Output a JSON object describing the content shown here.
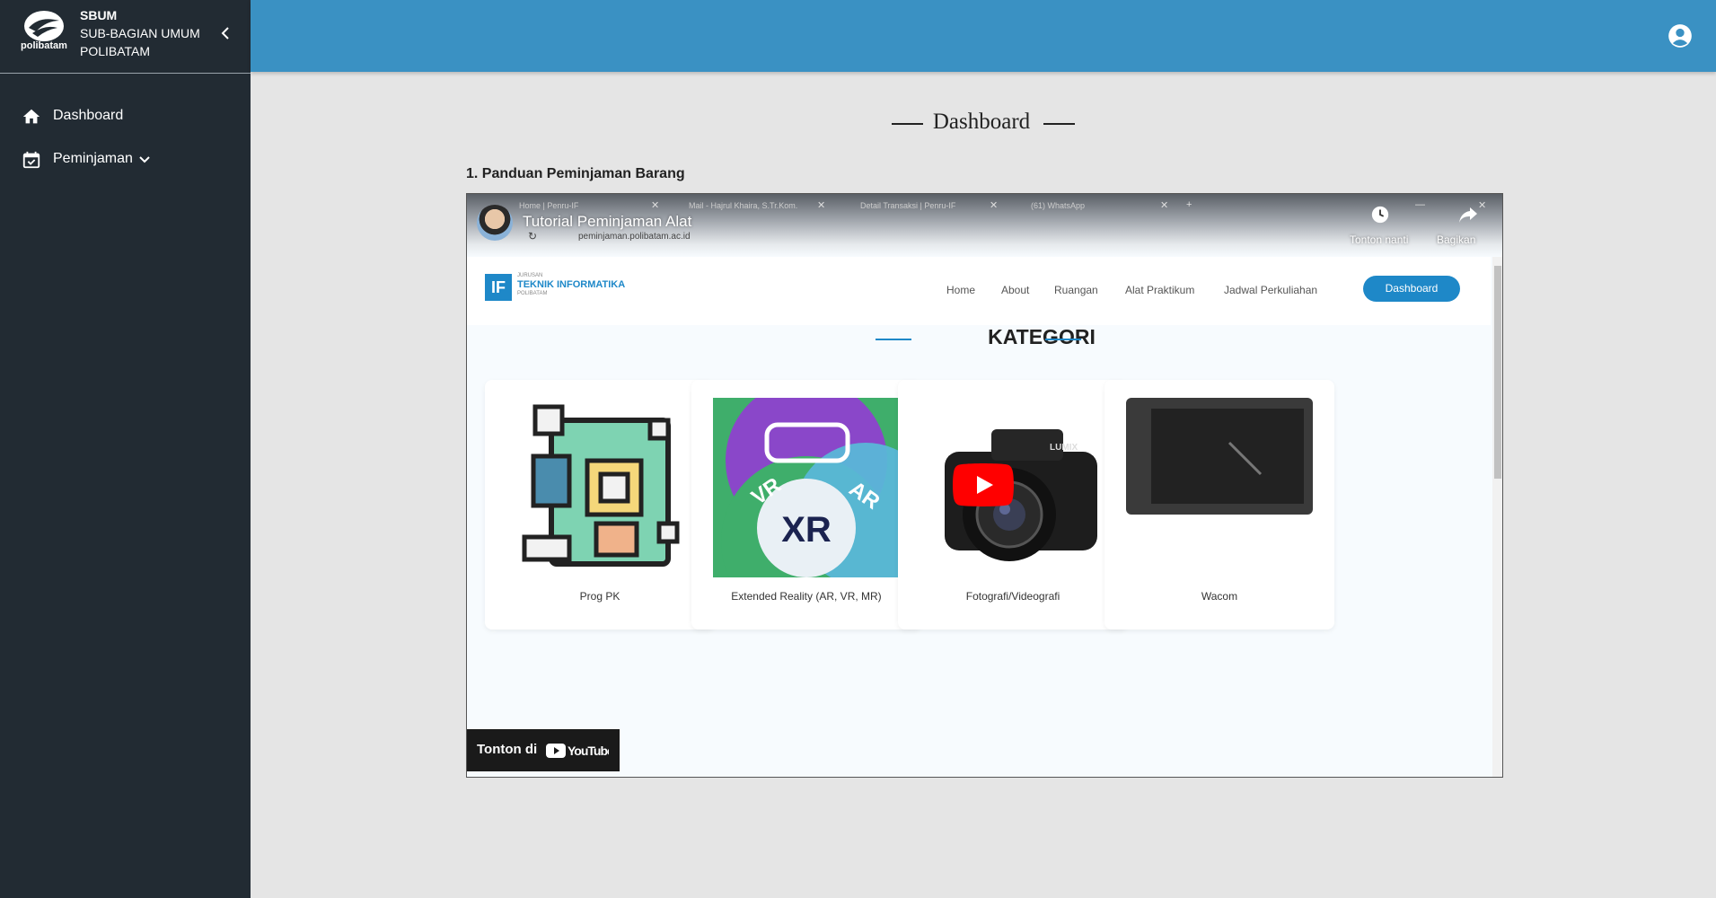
{
  "sidebar": {
    "brand": {
      "logo_text": "polibatam",
      "short": "SBUM",
      "line1": "SUB-BAGIAN UMUM",
      "line2": "POLIBATAM"
    },
    "nav": [
      {
        "label": "Dashboard",
        "icon": "home-icon"
      },
      {
        "label": "Peminjaman",
        "icon": "calendar-check-icon"
      }
    ]
  },
  "header": {
    "icon": "account-circle-icon"
  },
  "main": {
    "title": "Dashboard",
    "section_heading": "1. Panduan Peminjaman Barang"
  },
  "video": {
    "title": "Tutorial Peminjaman Alat",
    "watch_later": "Tonton nanti",
    "share": "Bagikan",
    "watch_on": "Tonton di",
    "youtube": "YouTube",
    "browser": {
      "tabs": [
        "Home | Penru-IF",
        "Mail - Hajrul Khaira, S.Tr.Kom.",
        "Detail Transaksi | Penru-IF",
        "(61) WhatsApp"
      ],
      "url": "peminjaman.polibatam.ac.id"
    },
    "site": {
      "logo_small": "JURUSAN",
      "logo_name": "TEKNIK INFORMATIKA",
      "logo_sub": "POLIBATAM",
      "nav": [
        "Home",
        "About",
        "Ruangan",
        "Alat Praktikum",
        "Jadwal Perkuliahan"
      ],
      "button": "Dashboard",
      "heading": "KATEGORI",
      "cards": [
        "Prog PK",
        "Extended Reality (AR, VR, MR)",
        "Fotografi/Videografi",
        "Wacom"
      ],
      "xr_labels": [
        "VR",
        "XR",
        "AR"
      ],
      "camera_brand": "LUMIX"
    }
  },
  "colors": {
    "sidebar": "#222b33",
    "topbar": "#3a91c3",
    "background": "#e5e5e5",
    "accent": "#1e88c8",
    "youtube_red": "#ff0000"
  }
}
